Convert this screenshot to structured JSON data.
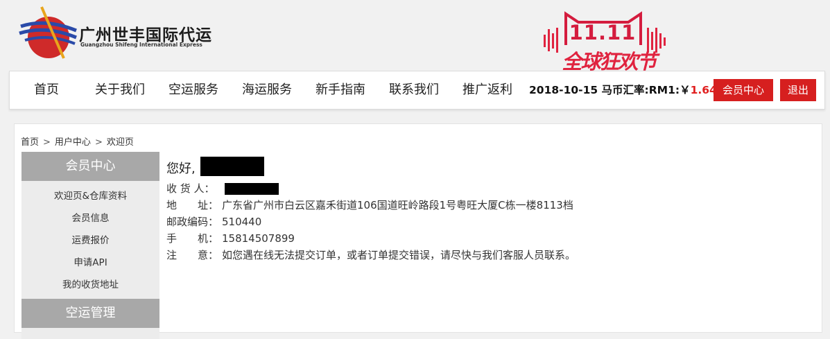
{
  "header": {
    "company_cn": "广州世丰国际代运",
    "company_en": "Guangzhou Shifeng International Express",
    "promo_number": "11.11",
    "promo_text": "全球狂欢节"
  },
  "nav": {
    "items": [
      "首页",
      "关于我们",
      "空运服务",
      "海运服务",
      "新手指南",
      "联系我们",
      "推广返利"
    ],
    "rate_prefix": "2018-10-15 马币汇率:RM1:￥",
    "rate_value": "1.64",
    "member_center_button": "会员中心",
    "logout_button": "退出"
  },
  "breadcrumb": {
    "items": [
      "首页",
      "用户中心",
      "欢迎页"
    ],
    "separator": ">"
  },
  "sidebar": {
    "section1_title": "会员中心",
    "items": [
      "欢迎页&仓库资料",
      "会员信息",
      "运费报价",
      "申请API",
      "我的收货地址"
    ],
    "section2_title": "空运管理"
  },
  "welcome": {
    "greeting": "您好,",
    "rows": [
      {
        "label": "收 货 人：",
        "value": ""
      },
      {
        "label": "地　　址：",
        "value": "广东省广州市白云区嘉禾街道106国道旺岭路段1号粤旺大厦C栋一楼8113档"
      },
      {
        "label": "邮政编码：",
        "value": "510440"
      },
      {
        "label": "手　　机：",
        "value": "15814507899"
      },
      {
        "label": "注　　意：",
        "value": "如您遇在线无法提交订单，或者订单提交错误，请尽快与我们客服人员联系。"
      }
    ]
  },
  "colors": {
    "accent_red": "#d61f1f",
    "sidebar_header": "#a8a8a8",
    "promo_red": "#e0233f"
  }
}
